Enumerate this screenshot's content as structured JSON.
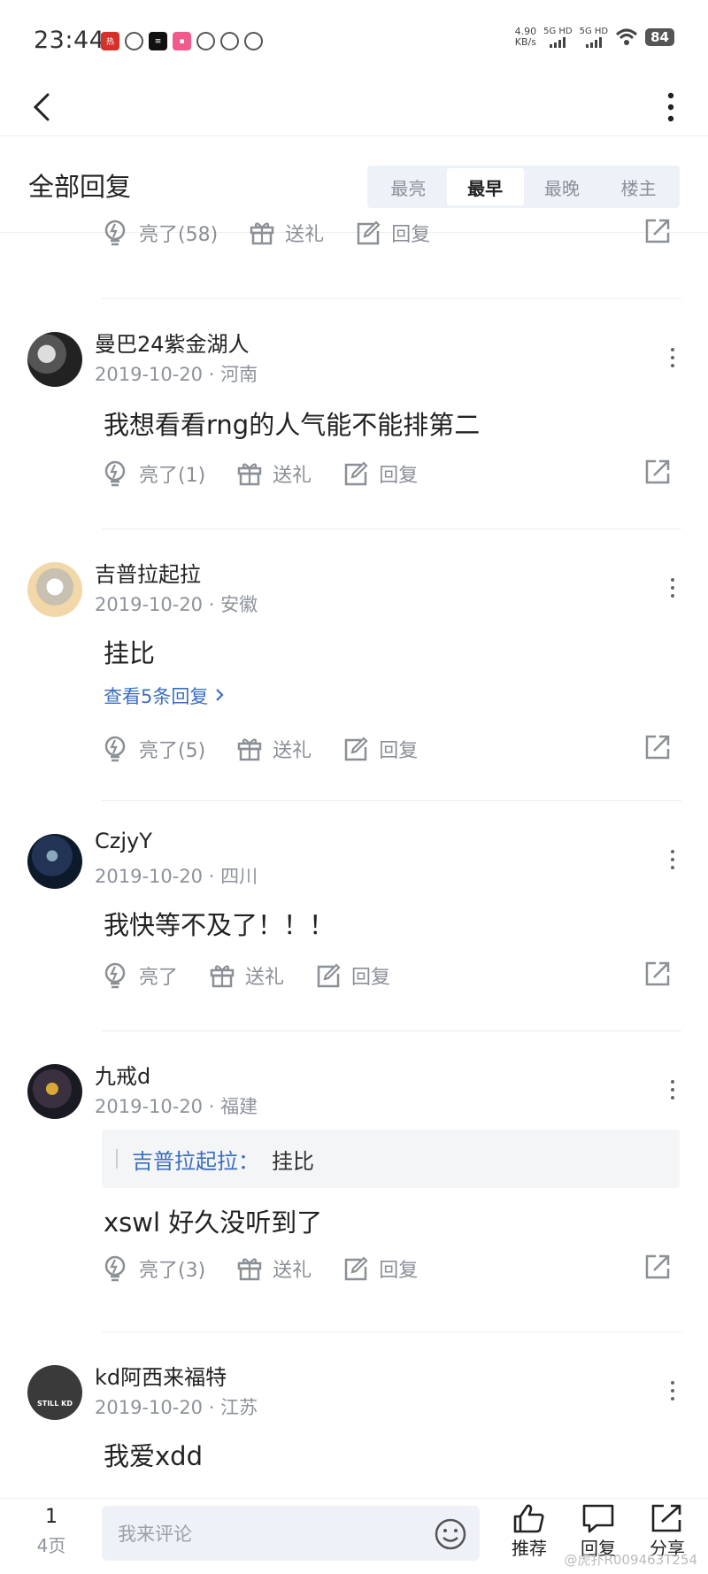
{
  "status_bar": {
    "time": "23:44",
    "net_speed_value": "4.90",
    "net_speed_unit": "KB/s",
    "signal1": "5G HD",
    "signal2": "5G HD",
    "battery": "84",
    "notif_icons": [
      {
        "name": "app-icon-1",
        "color": "#d6302a",
        "glyph": "热"
      },
      {
        "name": "weibo-icon",
        "color": "#ffffff",
        "glyph": ""
      },
      {
        "name": "app-icon-3",
        "color": "#111111",
        "glyph": "≡"
      },
      {
        "name": "app-icon-4",
        "color": "#f05a8c",
        "glyph": "▪"
      },
      {
        "name": "app-icon-5",
        "color": "#ffffff",
        "glyph": ""
      },
      {
        "name": "wechat-icon",
        "color": "#ffffff",
        "glyph": ""
      },
      {
        "name": "app-icon-7",
        "color": "#ffffff",
        "glyph": ""
      }
    ]
  },
  "header": {
    "section_title": "全部回复",
    "sort_tabs": [
      {
        "label": "最亮",
        "active": false
      },
      {
        "label": "最早",
        "active": true
      },
      {
        "label": "最晚",
        "active": false
      },
      {
        "label": "楼主",
        "active": false
      }
    ]
  },
  "top_actions": {
    "like": "亮了(58)",
    "gift": "送礼",
    "reply": "回复"
  },
  "comments": [
    {
      "username": "曼巴24紫金湖人",
      "date": "2019-10-20",
      "location": "河南",
      "text": "我想看看rng的人气能不能排第二",
      "like": "亮了(1)",
      "gift": "送礼",
      "reply": "回复"
    },
    {
      "username": "吉普拉起拉",
      "date": "2019-10-20",
      "location": "安徽",
      "text": "挂比",
      "view_replies": "查看5条回复",
      "like": "亮了(5)",
      "gift": "送礼",
      "reply": "回复"
    },
    {
      "username": "CzjyY",
      "date": "2019-10-20",
      "location": "四川",
      "text": "我快等不及了！！！",
      "like": "亮了",
      "gift": "送礼",
      "reply": "回复"
    },
    {
      "username": "九戒d",
      "date": "2019-10-20",
      "location": "福建",
      "quote_name": "吉普拉起拉：",
      "quote_text": "挂比",
      "text": "xswl 好久没听到了",
      "like": "亮了(3)",
      "gift": "送礼",
      "reply": "回复"
    },
    {
      "username": "kd阿西来福特",
      "date": "2019-10-20",
      "location": "江苏",
      "text": "我爱xdd",
      "avatar_text": "STILL KD"
    }
  ],
  "bottom_bar": {
    "page_current": "1",
    "page_total": "4页",
    "comment_placeholder": "我来评论",
    "recommend": "推荐",
    "reply": "回复",
    "share": "分享",
    "watermark": "@虎扑R009463T254"
  }
}
